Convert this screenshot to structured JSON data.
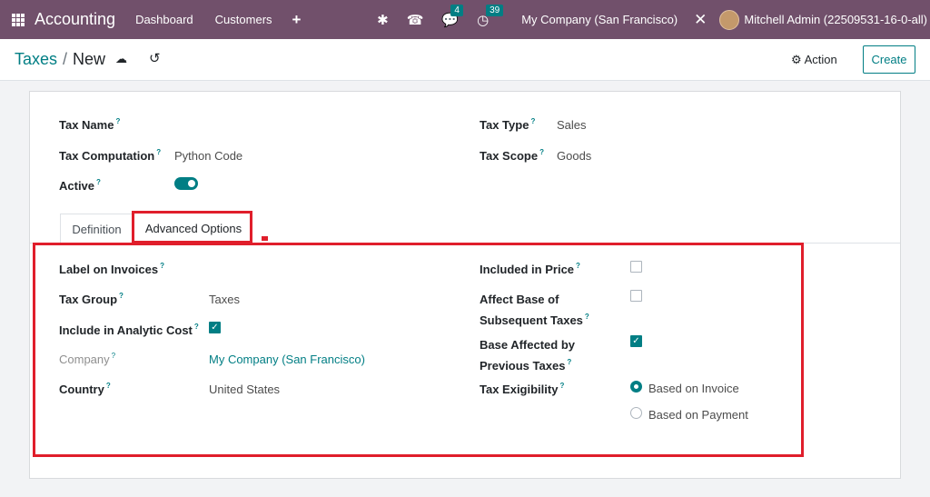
{
  "topbar": {
    "app_title": "Accounting",
    "nav": [
      "Dashboard",
      "Customers"
    ],
    "plus_icon": "plus-icon",
    "bug_icon": "bug-icon",
    "phone_icon": "phone-icon",
    "messages_badge": "4",
    "activities_badge": "39",
    "company": "My Company (San Francisco)",
    "user": "Mitchell Admin (22509531-16-0-all)",
    "bg_color": "#71506b"
  },
  "control": {
    "breadcrumb_parent": "Taxes",
    "breadcrumb_sep": "/",
    "breadcrumb_current": "New",
    "action_label": "Action",
    "create_label": "Create"
  },
  "form": {
    "tax_name_label": "Tax Name",
    "tax_computation_label": "Tax Computation",
    "tax_computation_value": "Python Code",
    "active_label": "Active",
    "tax_type_label": "Tax Type",
    "tax_type_value": "Sales",
    "tax_scope_label": "Tax Scope",
    "tax_scope_value": "Goods",
    "help_mark": "?"
  },
  "tabs": {
    "definition": "Definition",
    "advanced": "Advanced Options"
  },
  "advanced": {
    "label_on_invoices": "Label on Invoices",
    "tax_group_label": "Tax Group",
    "tax_group_value": "Taxes",
    "include_analytic_label": "Include in Analytic Cost",
    "company_label": "Company",
    "company_value": "My Company (San Francisco)",
    "country_label": "Country",
    "country_value": "United States",
    "included_in_price_label": "Included in Price",
    "affect_base_label_1": "Affect Base of",
    "affect_base_label_2": "Subsequent Taxes",
    "base_affected_label_1": "Base Affected by",
    "base_affected_label_2": "Previous Taxes",
    "tax_exigibility_label": "Tax Exigibility",
    "exigibility_options": [
      "Based on Invoice",
      "Based on Payment"
    ],
    "exigibility_selected": "Based on Invoice"
  },
  "colors": {
    "accent": "#017e84",
    "highlight": "#e01e2b"
  }
}
